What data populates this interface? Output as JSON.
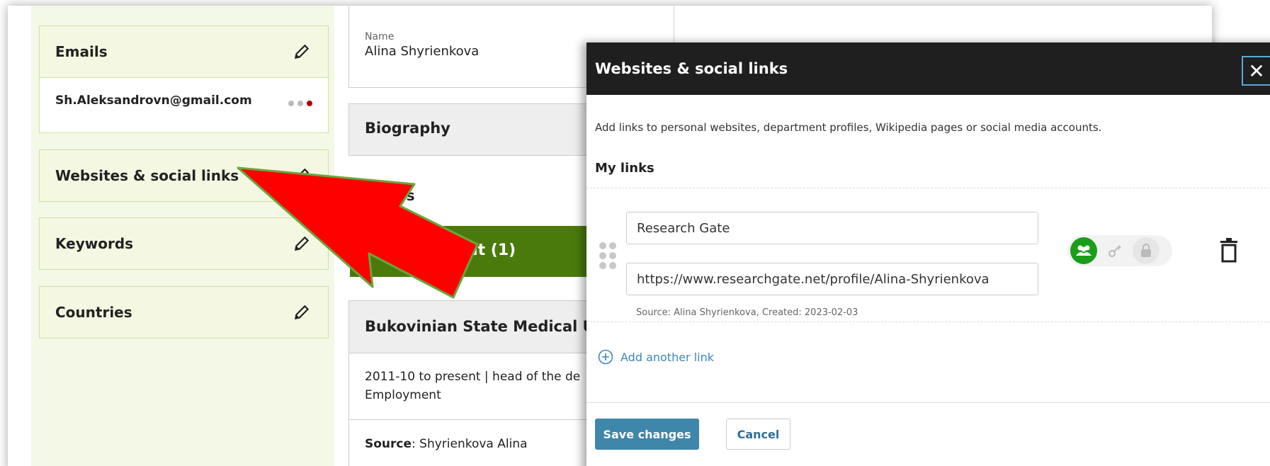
{
  "profile": {
    "emails": {
      "title": "Emails",
      "address": "Sh.Aleksandrovn@gmail.com"
    },
    "websites": {
      "title": "Websites & social links"
    },
    "keywords": {
      "title": "Keywords"
    },
    "countries": {
      "title": "Countries"
    },
    "name_label": "Name",
    "name_value": "Alina Shyrienkova",
    "biography": "Biography",
    "partial_heading": "es",
    "employment_label": "ent",
    "employment_count": "(1)",
    "org_title": "Bukovinian State Medical Univ",
    "org_line": "2011-10 to present | head of the de\nEmployment",
    "org_source_label": "Source",
    "org_source_value": ": Shyrienkova Alina"
  },
  "modal": {
    "title": "Websites & social links",
    "close_glyph": "✕",
    "description": "Add links to personal websites, department profiles, Wikipedia pages or social media accounts.",
    "section_title": "My links",
    "link": {
      "name": "Research Gate",
      "url": "https://www.researchgate.net/profile/Alina-Shyrienkova",
      "source": "Source: Alina Shyrienkova, Created: 2023-02-03",
      "visibility": "everyone"
    },
    "add_link": "Add another link",
    "save": "Save changes",
    "cancel": "Cancel"
  },
  "colors": {
    "accent_green": "#4a7a0c",
    "visibility_active": "#1a9e1a",
    "save_button": "#3e86aa",
    "arrow": "#ff0000"
  }
}
